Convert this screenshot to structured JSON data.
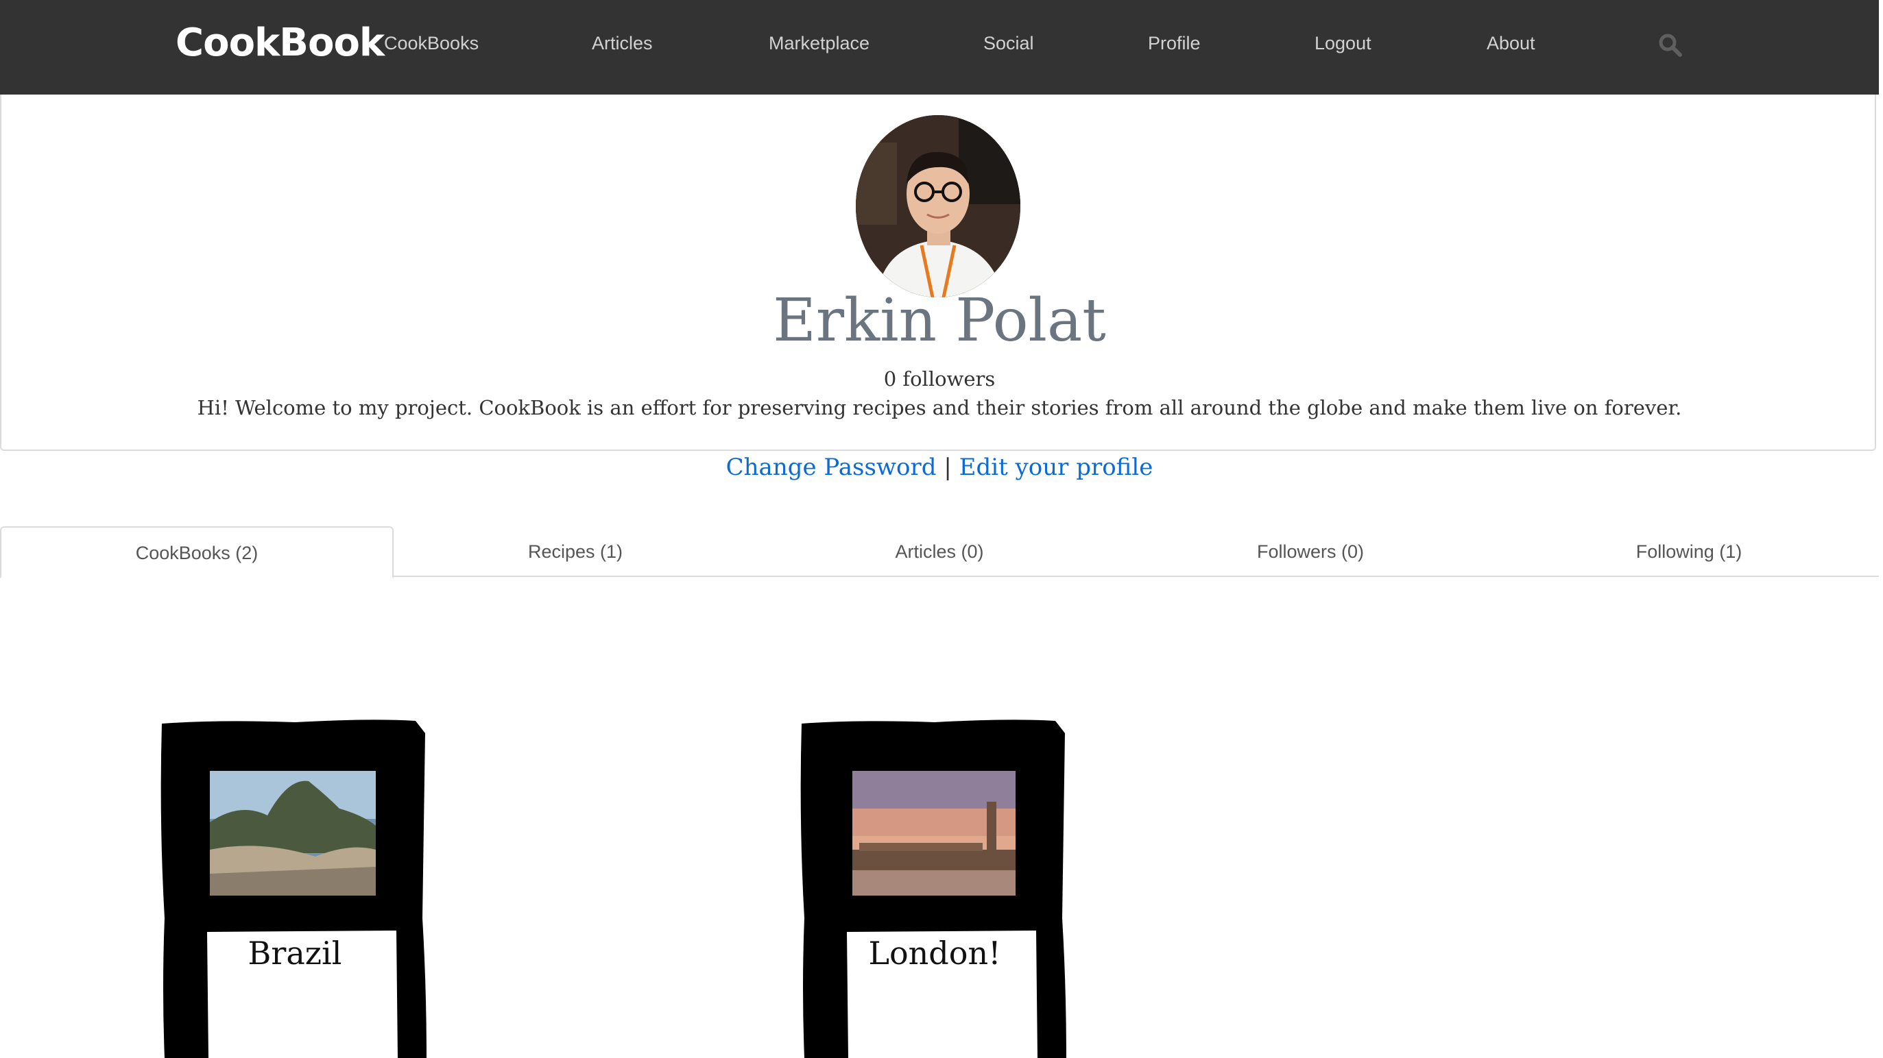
{
  "navbar": {
    "brand": "CookBook",
    "items": [
      {
        "label": "CookBooks"
      },
      {
        "label": "Articles"
      },
      {
        "label": "Marketplace"
      },
      {
        "label": "Social"
      },
      {
        "label": "Profile"
      },
      {
        "label": "Logout"
      },
      {
        "label": "About"
      }
    ],
    "search_icon": "search-icon"
  },
  "profile": {
    "name": "Erkin Polat",
    "followers_text": "0 followers",
    "bio": "Hi! Welcome to my project. CookBook is an effort for preserving recipes and their stories from all around the globe and make them live on forever.",
    "change_password": "Change Password",
    "separator": "|",
    "edit_profile": "Edit your profile"
  },
  "tabs": [
    {
      "label": "CookBooks (2)",
      "active": true
    },
    {
      "label": "Recipes (1)",
      "active": false
    },
    {
      "label": "Articles (0)",
      "active": false
    },
    {
      "label": "Followers (0)",
      "active": false
    },
    {
      "label": "Following (1)",
      "active": false
    }
  ],
  "cookbooks": [
    {
      "title": "Brazil"
    },
    {
      "title": "London!"
    }
  ],
  "colors": {
    "navbar_bg": "#333333",
    "link": "#0a6bd6",
    "name": "#6b7580"
  }
}
